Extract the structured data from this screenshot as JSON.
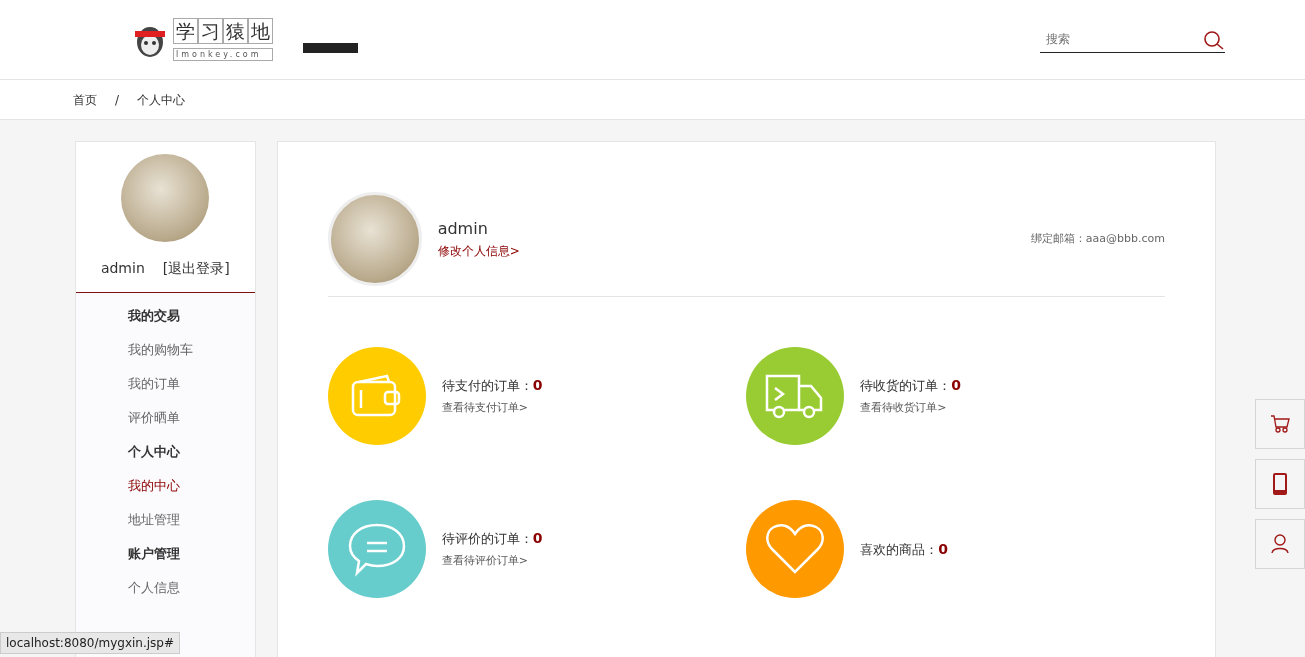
{
  "header": {
    "logo": {
      "title_chars": [
        "学",
        "习",
        "猿",
        "地"
      ],
      "subtitle": "lmonkey.com"
    },
    "search": {
      "placeholder": "搜索"
    }
  },
  "breadcrumb": {
    "separator": "/",
    "items": [
      "首页",
      "个人中心"
    ]
  },
  "sidebar": {
    "username": "admin",
    "logout": "[退出登录]",
    "groups": [
      {
        "title": "我的交易",
        "items": [
          {
            "label": "我的购物车",
            "selected": false
          },
          {
            "label": "我的订单",
            "selected": false
          },
          {
            "label": "评价晒单",
            "selected": false
          }
        ]
      },
      {
        "title": "个人中心",
        "items": [
          {
            "label": "我的中心",
            "selected": true
          },
          {
            "label": "地址管理",
            "selected": false
          }
        ]
      },
      {
        "title": "账户管理",
        "items": [
          {
            "label": "个人信息",
            "selected": false
          }
        ]
      }
    ]
  },
  "profile": {
    "username": "admin",
    "edit_link": "修改个人信息>",
    "email_label": "绑定邮箱：",
    "email": "aaa@bbb.com"
  },
  "stats": [
    {
      "kind": "wallet",
      "color": "#ffcc00",
      "label": "待支付的订单：",
      "count": "0",
      "link": "查看待支付订单>"
    },
    {
      "kind": "truck",
      "color": "#99cc33",
      "label": "待收货的订单：",
      "count": "0",
      "link": "查看待收货订单>"
    },
    {
      "kind": "chat",
      "color": "#66cccc",
      "label": "待评价的订单：",
      "count": "0",
      "link": "查看待评价订单>"
    },
    {
      "kind": "heart",
      "color": "#ff9900",
      "label": "喜欢的商品：",
      "count": "0"
    }
  ],
  "side_tools": [
    {
      "kind": "cart"
    },
    {
      "kind": "phone"
    },
    {
      "kind": "user"
    }
  ],
  "status_tooltip": "localhost:8080/mygxin.jsp#"
}
